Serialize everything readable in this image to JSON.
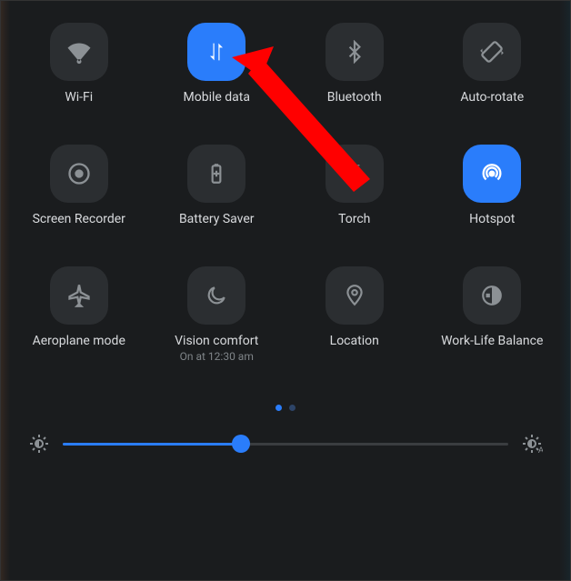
{
  "tiles": [
    {
      "key": "wifi",
      "label": "Wi-Fi",
      "active": false,
      "icon": "wifi-icon"
    },
    {
      "key": "mobile-data",
      "label": "Mobile data",
      "active": true,
      "icon": "mobile-data-icon"
    },
    {
      "key": "bluetooth",
      "label": "Bluetooth",
      "active": false,
      "icon": "bluetooth-icon"
    },
    {
      "key": "auto-rotate",
      "label": "Auto-rotate",
      "active": false,
      "icon": "auto-rotate-icon"
    },
    {
      "key": "screen-recorder",
      "label": "Screen Recorder",
      "active": false,
      "icon": "screen-recorder-icon"
    },
    {
      "key": "battery-saver",
      "label": "Battery Saver",
      "active": false,
      "icon": "battery-saver-icon"
    },
    {
      "key": "torch",
      "label": "Torch",
      "active": false,
      "icon": "torch-icon"
    },
    {
      "key": "hotspot",
      "label": "Hotspot",
      "active": true,
      "icon": "hotspot-icon"
    },
    {
      "key": "aeroplane-mode",
      "label": "Aeroplane mode",
      "active": false,
      "icon": "aeroplane-icon"
    },
    {
      "key": "vision-comfort",
      "label": "Vision comfort",
      "sublabel": "On at 12:30 am",
      "active": false,
      "icon": "moon-icon"
    },
    {
      "key": "location",
      "label": "Location",
      "active": false,
      "icon": "location-icon"
    },
    {
      "key": "work-life-balance",
      "label": "Work-Life Balance",
      "active": false,
      "icon": "work-life-icon"
    }
  ],
  "pager": {
    "current": 0,
    "count": 2
  },
  "brightness": {
    "value_percent": 40
  },
  "colors": {
    "accent": "#2a7dfb",
    "tile_bg": "#2b2e31",
    "panel_bg": "#1a1c1e"
  },
  "annotation_arrow": {
    "target": "mobile-data",
    "color": "#ff0000"
  }
}
